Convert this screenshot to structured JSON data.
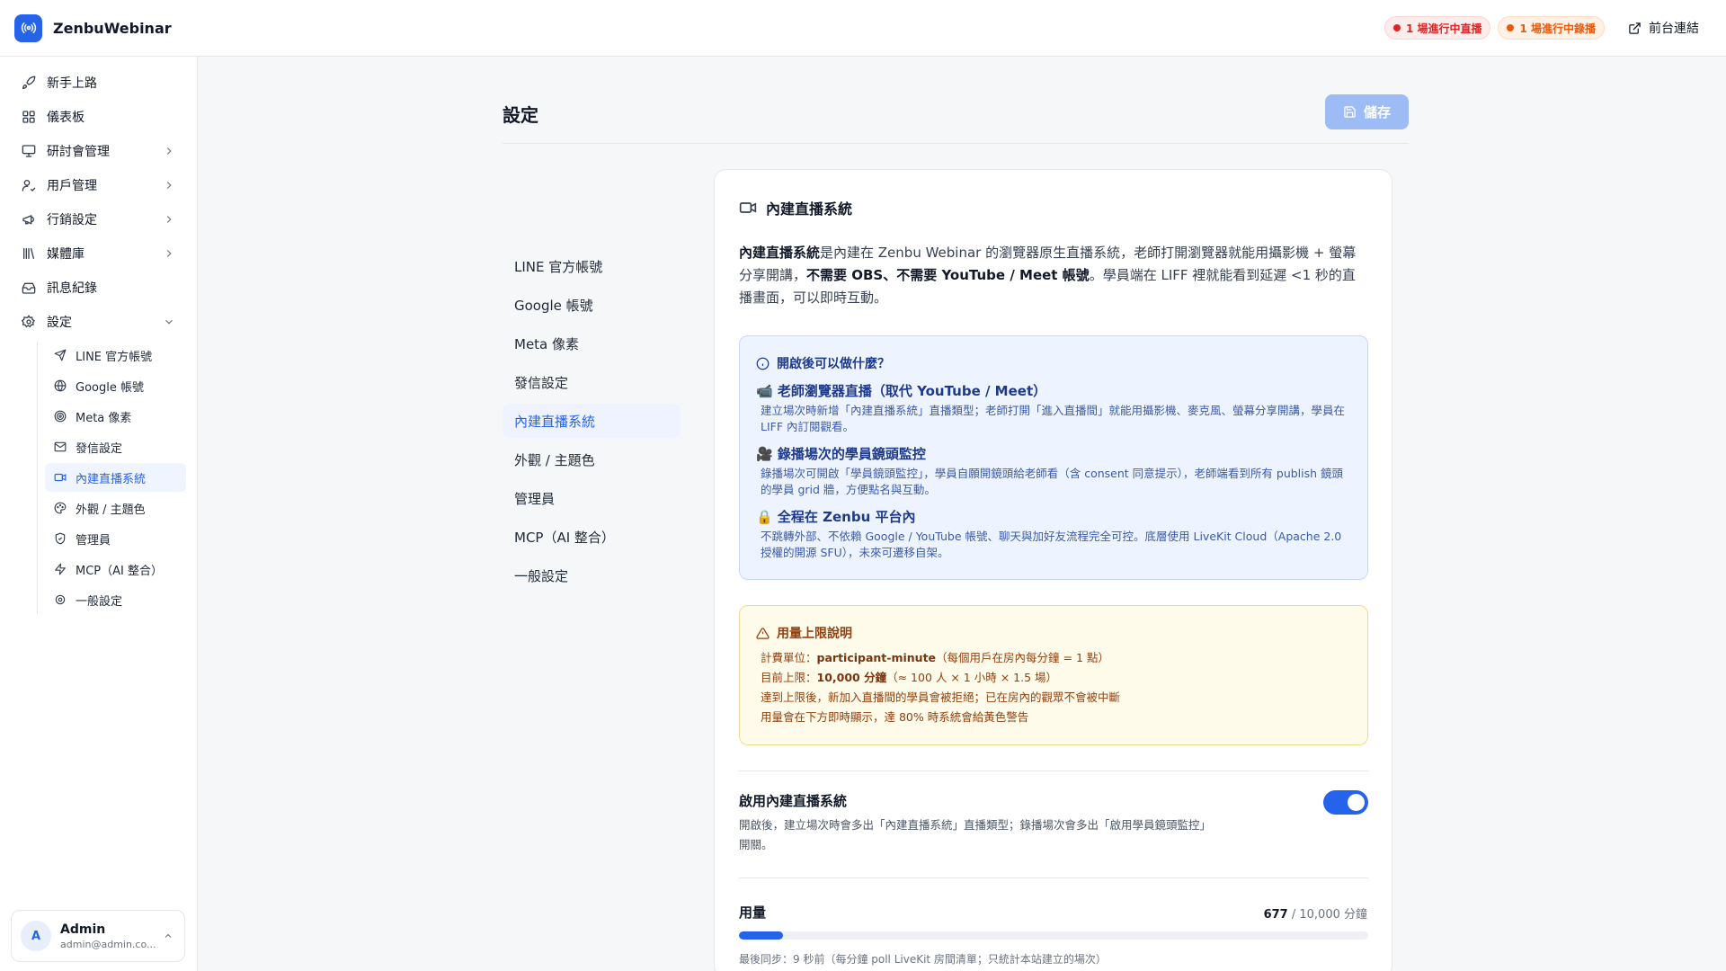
{
  "app": {
    "name": "ZenbuWebinar"
  },
  "topbar": {
    "live_badge": "1 場進行中直播",
    "recording_badge": "1 場進行中錄播",
    "front_link": "前台連結"
  },
  "sidebar": {
    "items": [
      {
        "label": "新手上路",
        "icon": "rocket-icon"
      },
      {
        "label": "儀表板",
        "icon": "grid-icon"
      },
      {
        "label": "研討會管理",
        "icon": "presentation-icon"
      },
      {
        "label": "用戶管理",
        "icon": "users-icon"
      },
      {
        "label": "行銷設定",
        "icon": "megaphone-icon"
      },
      {
        "label": "媒體庫",
        "icon": "library-icon"
      },
      {
        "label": "訊息紀錄",
        "icon": "inbox-icon"
      },
      {
        "label": "設定",
        "icon": "gear-icon"
      }
    ],
    "settings_sub": [
      {
        "label": "LINE 官方帳號",
        "icon": "send-icon"
      },
      {
        "label": "Google 帳號",
        "icon": "globe-icon"
      },
      {
        "label": "Meta 像素",
        "icon": "target-icon"
      },
      {
        "label": "發信設定",
        "icon": "mail-icon"
      },
      {
        "label": "內建直播系統",
        "icon": "video-icon"
      },
      {
        "label": "外觀 / 主題色",
        "icon": "palette-icon"
      },
      {
        "label": "管理員",
        "icon": "shield-icon"
      },
      {
        "label": "MCP（AI 整合）",
        "icon": "zap-icon"
      },
      {
        "label": "一般設定",
        "icon": "cog-icon"
      }
    ],
    "active_sub_index": 4,
    "user": {
      "initial": "A",
      "name": "Admin",
      "email": "admin@admin.co..."
    }
  },
  "page": {
    "title": "設定",
    "save_label": "儲存"
  },
  "settings_menu": [
    "LINE 官方帳號",
    "Google 帳號",
    "Meta 像素",
    "發信設定",
    "內建直播系統",
    "外觀 / 主題色",
    "管理員",
    "MCP（AI 整合）",
    "一般設定"
  ],
  "card": {
    "title": "內建直播系統",
    "intro": {
      "lead_bold": "內建直播系統",
      "text1": "是內建在 Zenbu Webinar 的瀏覽器原生直播系統，老師打開瀏覽器就能用攝影機 + 螢幕分享開講，",
      "bold2": "不需要 OBS、不需要 YouTube / Meet 帳號",
      "text2": "。學員端在 LIFF 裡就能看到延遲 <1 秒的直播畫面，可以即時互動。"
    },
    "info": {
      "title": "開啟後可以做什麼？",
      "features": [
        {
          "title": "📹 老師瀏覽器直播（取代 YouTube / Meet）",
          "desc": "建立場次時新增「內建直播系統」直播類型；老師打開「進入直播間」就能用攝影機、麥克風、螢幕分享開講，學員在 LIFF 內訂閱觀看。"
        },
        {
          "title": "🎥 錄播場次的學員鏡頭監控",
          "desc": "錄播場次可開啟「學員鏡頭監控」，學員自願開鏡頭給老師看（含 consent 同意提示），老師端看到所有 publish 鏡頭的學員 grid 牆，方便點名與互動。"
        },
        {
          "title": "🔒 全程在 Zenbu 平台內",
          "desc": "不跳轉外部、不依賴 Google / YouTube 帳號、聊天與加好友流程完全可控。底層使用 LiveKit Cloud（Apache 2.0 授權的開源 SFU），未來可遷移自架。"
        }
      ]
    },
    "warning": {
      "title": "用量上限說明",
      "line1_prefix": "計費單位：",
      "line1_bold": "participant-minute",
      "line1_suffix": "（每個用戶在房內每分鐘 = 1 點）",
      "line2_prefix": "目前上限：",
      "line2_bold": "10,000 分鐘",
      "line2_suffix": "（≈ 100 人 × 1 小時 × 1.5 場）",
      "line3": "達到上限後，新加入直播間的學員會被拒絕；已在房內的觀眾不會被中斷",
      "line4": "用量會在下方即時顯示，達 80% 時系統會給黃色警告"
    },
    "toggle": {
      "title": "啟用內建直播系統",
      "desc": "開啟後，建立場次時會多出「內建直播系統」直播類型；錄播場次會多出「啟用學員鏡頭監控」開關。",
      "enabled": true
    },
    "usage": {
      "title": "用量",
      "used": "677",
      "limit_text": " / 10,000 分鐘",
      "used_value": 677,
      "limit_value": 10000,
      "sync_note": "最後同步：9 秒前（每分鐘 poll LiveKit 房間清單；只統計本站建立的場次）"
    }
  },
  "colors": {
    "accent": "#2563eb",
    "live": "#dc2626",
    "recording": "#ea580c"
  }
}
